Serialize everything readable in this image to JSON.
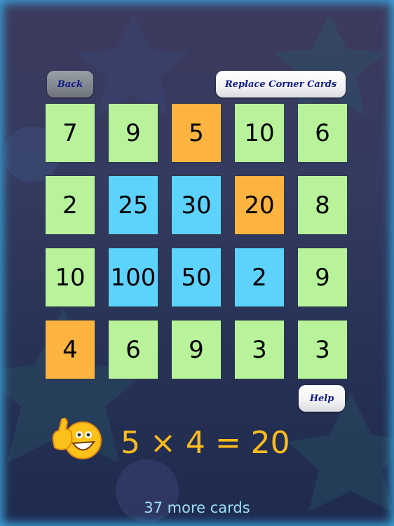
{
  "toolbar": {
    "back_label": "Back",
    "replace_label": "Replace Corner Cards",
    "help_label": "Help"
  },
  "colors": {
    "green": "#b8f29b",
    "orange": "#fdb340",
    "blue": "#5dd2fd",
    "equation": "#fdbb1c",
    "button_text": "#0e1a8a"
  },
  "grid": {
    "rows": [
      [
        {
          "value": "7",
          "color": "green"
        },
        {
          "value": "9",
          "color": "green"
        },
        {
          "value": "5",
          "color": "orange"
        },
        {
          "value": "10",
          "color": "green"
        },
        {
          "value": "6",
          "color": "green"
        }
      ],
      [
        {
          "value": "2",
          "color": "green"
        },
        {
          "value": "25",
          "color": "blue"
        },
        {
          "value": "30",
          "color": "blue"
        },
        {
          "value": "20",
          "color": "orange"
        },
        {
          "value": "8",
          "color": "green"
        }
      ],
      [
        {
          "value": "10",
          "color": "green"
        },
        {
          "value": "100",
          "color": "blue"
        },
        {
          "value": "50",
          "color": "blue"
        },
        {
          "value": "2",
          "color": "blue"
        },
        {
          "value": "9",
          "color": "green"
        }
      ],
      [
        {
          "value": "4",
          "color": "orange"
        },
        {
          "value": "6",
          "color": "green"
        },
        {
          "value": "9",
          "color": "green"
        },
        {
          "value": "3",
          "color": "green"
        },
        {
          "value": "3",
          "color": "green"
        }
      ]
    ]
  },
  "feedback": {
    "icon": "thumbs-up-smiley-icon",
    "equation": "5 × 4 = 20"
  },
  "status": {
    "remaining": "37 more cards"
  }
}
